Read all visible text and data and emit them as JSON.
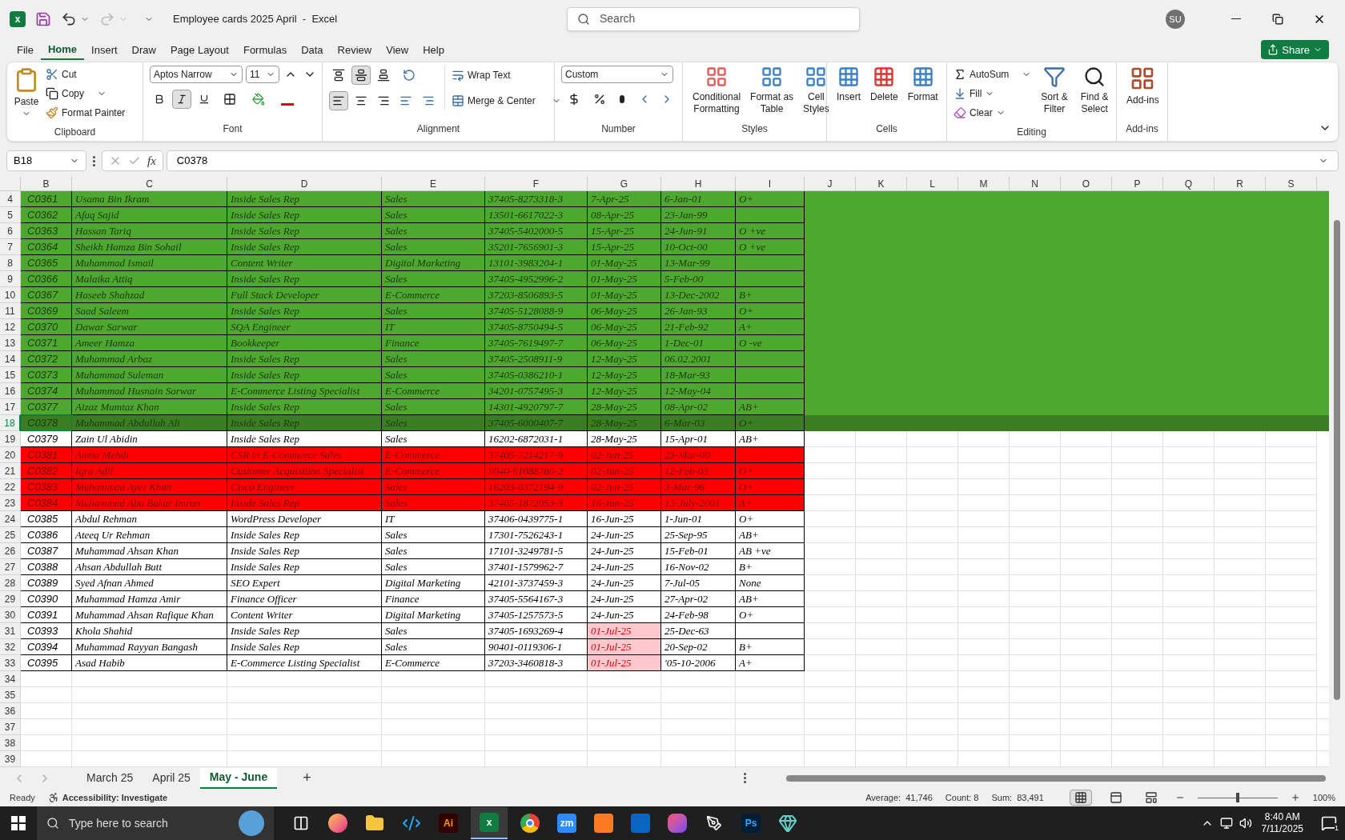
{
  "window": {
    "app_glyph": "x",
    "title": "Employee cards 2025 April  -  Excel",
    "search_placeholder": "Search",
    "user_initials": "SU"
  },
  "menu_tabs": [
    {
      "label": "File",
      "selected": false
    },
    {
      "label": "Home",
      "selected": true
    },
    {
      "label": "Insert",
      "selected": false
    },
    {
      "label": "Draw",
      "selected": false
    },
    {
      "label": "Page Layout",
      "selected": false
    },
    {
      "label": "Formulas",
      "selected": false
    },
    {
      "label": "Data",
      "selected": false
    },
    {
      "label": "Review",
      "selected": false
    },
    {
      "label": "View",
      "selected": false
    },
    {
      "label": "Help",
      "selected": false
    }
  ],
  "share_button": "Share",
  "ribbon": {
    "clipboard": {
      "title": "Clipboard",
      "paste": "Paste",
      "cut": "Cut",
      "copy": "Copy",
      "format_painter": "Format Painter"
    },
    "font": {
      "title": "Font",
      "family": "Aptos Narrow",
      "size": "11",
      "bold_selected": false,
      "italic_selected": true,
      "underline_selected": false
    },
    "alignment": {
      "title": "Alignment",
      "middle_selected": true,
      "left_selected": true,
      "wrap_text": "Wrap Text",
      "merge_center": "Merge & Center"
    },
    "number": {
      "title": "Number",
      "format": "Custom"
    },
    "styles": {
      "title": "Styles",
      "buttons": [
        [
          "Conditional",
          "Formatting"
        ],
        [
          "Format as",
          "Table"
        ],
        [
          "Cell",
          "Styles"
        ]
      ]
    },
    "cells": {
      "title": "Cells",
      "buttons": [
        "Insert",
        "Delete",
        "Format"
      ]
    },
    "editing": {
      "title": "Editing",
      "autosum": "AutoSum",
      "fill": "Fill",
      "clear": "Clear",
      "sort_filter": [
        "Sort &",
        "Filter"
      ],
      "find_select": [
        "Find &",
        "Select"
      ]
    },
    "addins": {
      "title": "Add-ins",
      "button": "Add-ins"
    }
  },
  "formula_bar": {
    "name_box": "B18",
    "function_label": "fx",
    "formula": "C0378"
  },
  "columns": [
    "B",
    "C",
    "D",
    "E",
    "F",
    "G",
    "H",
    "I",
    "J",
    "K",
    "L",
    "M",
    "N",
    "O",
    "P",
    "Q",
    "R",
    "S"
  ],
  "rows": [
    {
      "number": "4",
      "kind": "green",
      "selected": false,
      "date_flagged": false,
      "cells": [
        "C0361",
        "Usama Bin Ikram",
        "Inside Sales Rep",
        "Sales",
        "37405-8273318-3",
        "7-Apr-25",
        "6-Jan-01",
        "O+"
      ]
    },
    {
      "number": "5",
      "kind": "green",
      "selected": false,
      "date_flagged": false,
      "cells": [
        "C0362",
        "Afaq Sajid",
        "Inside Sales Rep",
        "Sales",
        "13501-6617022-3",
        "08-Apr-25",
        "23-Jan-99",
        null
      ]
    },
    {
      "number": "6",
      "kind": "green",
      "selected": false,
      "date_flagged": false,
      "cells": [
        "C0363",
        "Hassan Tariq",
        "Inside Sales Rep",
        "Sales",
        "37405-5402000-5",
        "15-Apr-25",
        "24-Jun-91",
        "O +ve"
      ]
    },
    {
      "number": "7",
      "kind": "green",
      "selected": false,
      "date_flagged": false,
      "cells": [
        "C0364",
        "Sheikh Hamza Bin Sohail",
        "Inside Sales Rep",
        "Sales",
        "35201-7656901-3",
        "15-Apr-25",
        "10-Oct-00",
        "O +ve"
      ]
    },
    {
      "number": "8",
      "kind": "green",
      "selected": false,
      "date_flagged": false,
      "cells": [
        "C0365",
        "Muhammad Ismail",
        "Content Writer",
        "Digital Marketing",
        "13101-3983204-1",
        "01-May-25",
        "13-Mar-99",
        null
      ]
    },
    {
      "number": "9",
      "kind": "green",
      "selected": false,
      "date_flagged": false,
      "cells": [
        "C0366",
        "Malaika Attiq",
        "Inside Sales Rep",
        "Sales",
        "37405-4952996-2",
        "01-May-25",
        "5-Feb-00",
        null
      ]
    },
    {
      "number": "10",
      "kind": "green",
      "selected": false,
      "date_flagged": false,
      "cells": [
        "C0367",
        "Haseeb Shahzad",
        "Full Stack Developer",
        "E-Commerce",
        "37203-8506893-5",
        "01-May-25",
        "13-Dec-2002",
        "B+"
      ]
    },
    {
      "number": "11",
      "kind": "green",
      "selected": false,
      "date_flagged": false,
      "cells": [
        "C0369",
        "Saad Saleem",
        "Inside Sales Rep",
        "Sales",
        "37405-5128088-9",
        "06-May-25",
        "26-Jan-93",
        "O+"
      ]
    },
    {
      "number": "12",
      "kind": "green",
      "selected": false,
      "date_flagged": false,
      "cells": [
        "C0370",
        "Dawar Sarwar",
        "SQA Engineer",
        "IT",
        "37405-8750494-5",
        "06-May-25",
        "21-Feb-92",
        "A+"
      ]
    },
    {
      "number": "13",
      "kind": "green",
      "selected": false,
      "date_flagged": false,
      "cells": [
        "C0371",
        "Ameer Hamza",
        "Bookkeeper",
        "Finance",
        "37405-7619497-7",
        "06-May-25",
        "1-Dec-01",
        "O -ve"
      ]
    },
    {
      "number": "14",
      "kind": "green",
      "selected": false,
      "date_flagged": false,
      "cells": [
        "C0372",
        "Muhammad Arbaz",
        "Inside Sales Rep",
        "Sales",
        "37405-2508911-9",
        "12-May-25",
        "06.02.2001",
        null
      ]
    },
    {
      "number": "15",
      "kind": "green",
      "selected": false,
      "date_flagged": false,
      "cells": [
        "C0373",
        "Muhammad Suleman",
        "Inside Sales Rep",
        "Sales",
        "37405-0386210-1",
        "12-May-25",
        "18-Mar-93",
        null
      ]
    },
    {
      "number": "16",
      "kind": "green",
      "selected": false,
      "date_flagged": false,
      "cells": [
        "C0374",
        "Muhammad Husnain Sarwar",
        "E-Commerce Listing Specialist",
        "E-Commerce",
        "34201-0757495-3",
        "12-May-25",
        "12-May-04",
        null
      ]
    },
    {
      "number": "17",
      "kind": "green",
      "selected": false,
      "date_flagged": false,
      "cells": [
        "C0377",
        "Aizaz Mumtaz Khan",
        "Inside Sales Rep",
        "Sales",
        "14301-4920797-7",
        "28-May-25",
        "08-Apr-02",
        "AB+"
      ]
    },
    {
      "number": "18",
      "kind": "green",
      "selected": true,
      "date_flagged": false,
      "cells": [
        "C0378",
        "Muhammad Abdullah Ali",
        "Inside Sales Rep",
        "Sales",
        "37405-6000407-7",
        "28-May-25",
        "6-Mar-03",
        "O+"
      ]
    },
    {
      "number": "19",
      "kind": "none",
      "selected": false,
      "date_flagged": false,
      "cells": [
        "C0379",
        "Zain Ul Abidin",
        "Inside Sales Rep",
        "Sales",
        "16202-6872031-1",
        "28-May-25",
        "15-Apr-01",
        "AB+"
      ]
    },
    {
      "number": "20",
      "kind": "red",
      "selected": false,
      "date_flagged": false,
      "cells": [
        "C0381",
        "Amna Mehdi",
        "CSR in E-Commerce Sales",
        "E-Commerce",
        "37405-7214217-9",
        "02-Jun-25",
        "23-Mar-00",
        null
      ]
    },
    {
      "number": "21",
      "kind": "red",
      "selected": false,
      "date_flagged": false,
      "cells": [
        "C0382",
        "Iqra Adil",
        "Customer Acquisition Specialist",
        "E-Commerce",
        "9040-61088780-2",
        "02-Jun-25",
        "12-Feb-03",
        "O+"
      ]
    },
    {
      "number": "22",
      "kind": "red",
      "selected": false,
      "date_flagged": false,
      "cells": [
        "C0383",
        "Muhammad Ayez Khan",
        "Cisco Engineer",
        "Sales",
        "16203-0372194-9",
        "02-Jun-25",
        "3-Mar-96",
        "O+"
      ]
    },
    {
      "number": "23",
      "kind": "red",
      "selected": false,
      "date_flagged": false,
      "cells": [
        "C0384",
        "Muhammad Abu Bakar Imran",
        "Inside Sales Rep",
        "Sales",
        "37405-1872053-3",
        "16-Jun-25",
        "13-July-2001",
        "A+"
      ]
    },
    {
      "number": "24",
      "kind": "none",
      "selected": false,
      "date_flagged": false,
      "cells": [
        "C0385",
        "Abdul Rehman",
        "WordPress Developer",
        "IT",
        "37406-0439775-1",
        "16-Jun-25",
        "1-Jun-01",
        "O+"
      ]
    },
    {
      "number": "25",
      "kind": "none",
      "selected": false,
      "date_flagged": false,
      "cells": [
        "C0386",
        "Ateeq Ur Rehman",
        "Inside Sales Rep",
        "Sales",
        "17301-7526243-1",
        "24-Jun-25",
        "25-Sep-95",
        "AB+"
      ]
    },
    {
      "number": "26",
      "kind": "none",
      "selected": false,
      "date_flagged": false,
      "cells": [
        "C0387",
        "Muhammad Ahsan Khan",
        "Inside Sales Rep",
        "Sales",
        "17101-3249781-5",
        "24-Jun-25",
        "15-Feb-01",
        "AB +ve"
      ]
    },
    {
      "number": "27",
      "kind": "none",
      "selected": false,
      "date_flagged": false,
      "cells": [
        "C0388",
        "Ahsan Abdullah Butt",
        "Inside Sales Rep",
        "Sales",
        "37401-1579962-7",
        "24-Jun-25",
        "16-Nov-02",
        "B+"
      ]
    },
    {
      "number": "28",
      "kind": "none",
      "selected": false,
      "date_flagged": false,
      "cells": [
        "C0389",
        "Syed Afnan Ahmed",
        "SEO Expert",
        "Digital Marketing",
        "42101-3737459-3",
        "24-Jun-25",
        "7-Jul-05",
        "None"
      ]
    },
    {
      "number": "29",
      "kind": "none",
      "selected": false,
      "date_flagged": false,
      "cells": [
        "C0390",
        "Muhammad Hamza Amir",
        "Finance Officer",
        "Finance",
        "37405-5564167-3",
        "24-Jun-25",
        "27-Apr-02",
        "AB+"
      ]
    },
    {
      "number": "30",
      "kind": "none",
      "selected": false,
      "date_flagged": false,
      "cells": [
        "C0391",
        "Muhammad Ahsan Rafique Khan",
        "Content Writer",
        "Digital Marketing",
        "37405-1257573-5",
        "24-Jun-25",
        "24-Feb-98",
        "O+"
      ]
    },
    {
      "number": "31",
      "kind": "none",
      "selected": false,
      "date_flagged": true,
      "cells": [
        "C0393",
        "Khola Shahid",
        "Inside Sales Rep",
        "Sales",
        "37405-1693269-4",
        "01-Jul-25",
        "25-Dec-63",
        null
      ]
    },
    {
      "number": "32",
      "kind": "none",
      "selected": false,
      "date_flagged": true,
      "cells": [
        "C0394",
        "Muhammad Rayyan Bangash",
        "Inside Sales Rep",
        "Sales",
        "90401-0119306-1",
        "01-Jul-25",
        "20-Sep-02",
        "B+"
      ]
    },
    {
      "number": "33",
      "kind": "none",
      "selected": false,
      "date_flagged": true,
      "cells": [
        "C0395",
        "Asad Habib",
        "E-Commerce Listing Specialist",
        "E-Commerce",
        "37203-3460818-3",
        "01-Jul-25",
        "'05-10-2006",
        "A+"
      ]
    }
  ],
  "empty_rows": [
    "34",
    "35",
    "36",
    "37",
    "38",
    "39"
  ],
  "sheet_tabs": [
    {
      "label": "March 25",
      "selected": false
    },
    {
      "label": "April 25",
      "selected": false
    },
    {
      "label": "May - June",
      "selected": true
    }
  ],
  "add_sheet": "+",
  "status_bar": {
    "mode": "Ready",
    "accessibility": "Accessibility: Investigate",
    "average": "Average:  41,746",
    "count": "Count: 8",
    "sum": "Sum:  83,491",
    "zoom_slider": {
      "level": 0.5
    },
    "zoom": "100%"
  },
  "taskbar": {
    "search_placeholder": "Type here to search",
    "apps": [
      {
        "kind": "taskview"
      },
      {
        "kind": "firefox"
      },
      {
        "kind": "folder"
      },
      {
        "kind": "vscode"
      },
      {
        "kind": "logo",
        "glyph": "Ai",
        "color": "#330000"
      },
      {
        "kind": "excel",
        "glyph": "x"
      },
      {
        "kind": "chrome"
      },
      {
        "kind": "logo",
        "glyph": "zm",
        "color": "#2d8cff"
      },
      {
        "kind": "xampp"
      },
      {
        "kind": "outlook"
      },
      {
        "kind": "creative"
      },
      {
        "kind": "pen"
      },
      {
        "kind": "logo",
        "glyph": "Ps",
        "color": "#001e36"
      },
      {
        "kind": "gem"
      }
    ],
    "time": "8:40 AM",
    "date": "7/11/2025",
    "notifications": "1"
  }
}
